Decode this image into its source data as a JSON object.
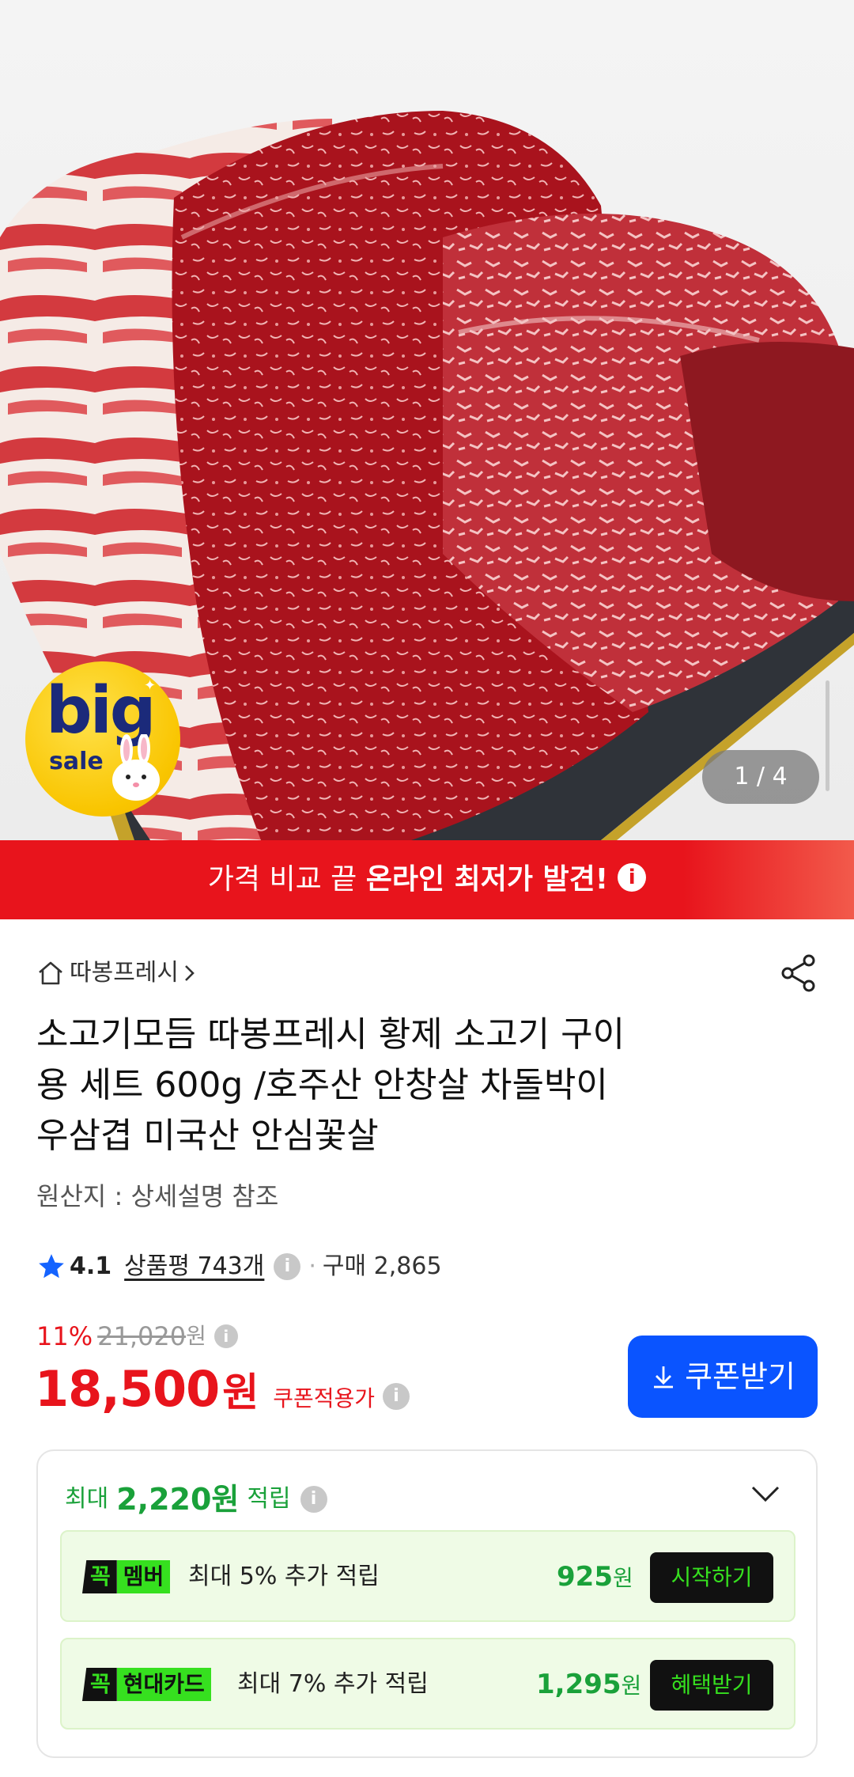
{
  "hero": {
    "badge_big": "big",
    "badge_sale": "sale",
    "pager": "1 / 4"
  },
  "banner": {
    "text_normal": "가격 비교 끝 ",
    "text_bold": "온라인 최저가 발견!",
    "info": "i"
  },
  "product": {
    "store": "따봉프레시",
    "title_line1": "소고기모듬 따봉프레시 황제 소고기 구이",
    "title_line2": "용 세트 600g /호주산 안창살 차돌박이",
    "title_line3": "우삼겹 미국산 안심꽃살",
    "origin": "원산지 : 상세설명 참조",
    "rating": "4.1",
    "review_label": "상품평 743개",
    "purchase_label": "구매 2,865"
  },
  "price": {
    "discount": "11%",
    "original": "21,020",
    "original_unit": "원",
    "sale": "18,500",
    "sale_unit": "원",
    "coupon_label": "쿠폰적용가",
    "coupon_button": "쿠폰받기"
  },
  "rewards": {
    "prefix": "최대",
    "amount": "2,220원",
    "suffix": "적립",
    "rows": [
      {
        "tag_kk": "꼭",
        "tag_name": "멤버",
        "desc": "최대 5% 추가 적립",
        "value": "925",
        "unit": "원",
        "action": "시작하기"
      },
      {
        "tag_kk": "꼭",
        "tag_name": "현대카드",
        "desc": "최대 7% 추가 적립",
        "value": "1,295",
        "unit": "원",
        "action": "혜택받기"
      }
    ]
  },
  "colors": {
    "accent_red": "#e8141c",
    "coupon_blue": "#0a54ff",
    "reward_green": "#1aa13a",
    "tag_green": "#36e01f"
  },
  "icons": [
    "home-icon",
    "chevron-right-icon",
    "share-icon",
    "star-icon",
    "info-icon",
    "download-icon",
    "chevron-down-icon"
  ]
}
